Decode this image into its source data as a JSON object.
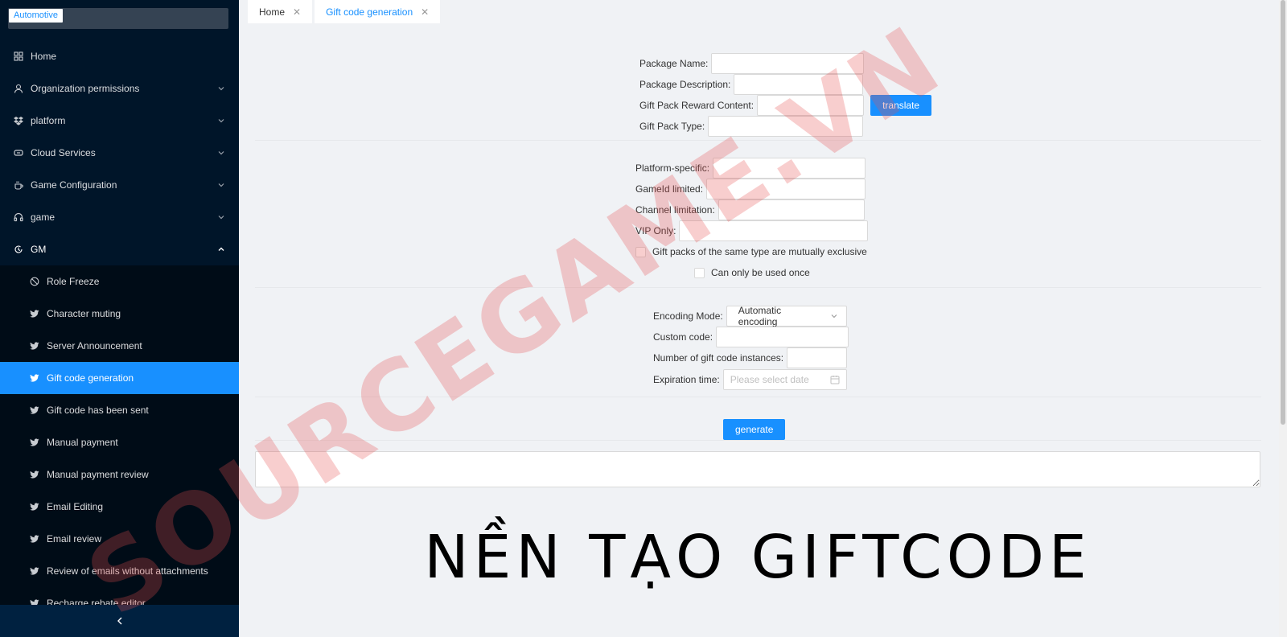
{
  "brand": {
    "tag": "Automotive"
  },
  "menu": [
    {
      "label": "Home",
      "icon": "dashboard-icon"
    },
    {
      "label": "Organization permissions",
      "icon": "user-icon"
    },
    {
      "label": "platform",
      "icon": "dropbox-icon"
    },
    {
      "label": "Cloud Services",
      "icon": "cloud-link-icon"
    },
    {
      "label": "Game Configuration",
      "icon": "coffee-icon"
    },
    {
      "label": "game",
      "icon": "headphones-icon"
    },
    {
      "label": "GM",
      "icon": "gm-icon"
    }
  ],
  "gm_submenu": [
    {
      "label": "Role Freeze",
      "icon": "stop-icon"
    },
    {
      "label": "Character muting",
      "icon": "bird-icon"
    },
    {
      "label": "Server Announcement",
      "icon": "bird-icon"
    },
    {
      "label": "Gift code generation",
      "icon": "bird-icon",
      "active": true
    },
    {
      "label": "Gift code has been sent",
      "icon": "bird-icon"
    },
    {
      "label": "Manual payment",
      "icon": "bird-icon"
    },
    {
      "label": "Manual payment review",
      "icon": "bird-icon"
    },
    {
      "label": "Email Editing",
      "icon": "bird-icon"
    },
    {
      "label": "Email review",
      "icon": "bird-icon"
    },
    {
      "label": "Review of emails without attachments",
      "icon": "bird-icon"
    },
    {
      "label": "Recharge rebate editor",
      "icon": "bird-icon"
    }
  ],
  "tabs": [
    {
      "label": "Home",
      "active": false
    },
    {
      "label": "Gift code generation",
      "active": true
    }
  ],
  "form": {
    "package_name": {
      "label": "Package Name:",
      "value": ""
    },
    "package_description": {
      "label": "Package Description:",
      "value": ""
    },
    "reward_content": {
      "label": "Gift Pack Reward Content:",
      "value": ""
    },
    "translate_label": "translate",
    "pack_type": {
      "label": "Gift Pack Type:",
      "value": ""
    },
    "platform_specific": {
      "label": "Platform-specific:",
      "value": ""
    },
    "gameid_limited": {
      "label": "GameId limited:",
      "value": ""
    },
    "channel_limitation": {
      "label": "Channel limitation:",
      "value": ""
    },
    "vip_only": {
      "label": "VIP Only:",
      "value": ""
    },
    "mutually_exclusive": {
      "label": "Gift packs of the same type are mutually exclusive",
      "checked": false
    },
    "use_once": {
      "label": "Can only be used once",
      "checked": false
    },
    "encoding_mode": {
      "label": "Encoding Mode:",
      "value": "Automatic encoding"
    },
    "custom_code": {
      "label": "Custom code:",
      "value": ""
    },
    "instances": {
      "label": "Number of gift code instances:",
      "value": ""
    },
    "expiration": {
      "label": "Expiration time:",
      "placeholder": "Please select date"
    },
    "generate_label": "generate",
    "output": ""
  },
  "overlay": {
    "watermark": "SOURCEGAME.VN",
    "banner": "NỀN TẠO GIFTCODE"
  },
  "colors": {
    "accent": "#1890ff",
    "sidebar": "#001529",
    "submenu": "#000c17",
    "watermark": "#e65050"
  }
}
